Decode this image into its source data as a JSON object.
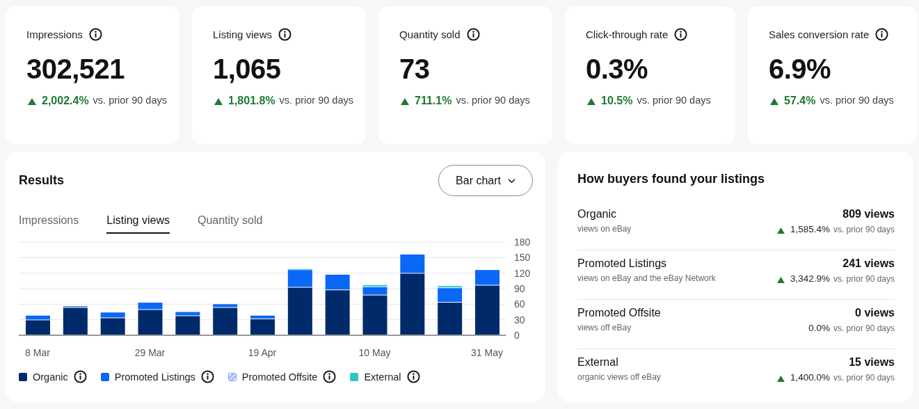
{
  "metrics": [
    {
      "label": "Impressions",
      "value": "302,521",
      "change": "2,002.4%",
      "up": true,
      "comparison": "vs. prior 90 days"
    },
    {
      "label": "Listing views",
      "value": "1,065",
      "change": "1,801.8%",
      "up": true,
      "comparison": "vs. prior 90 days"
    },
    {
      "label": "Quantity sold",
      "value": "73",
      "change": "711.1%",
      "up": true,
      "comparison": "vs. prior 90 days"
    },
    {
      "label": "Click-through rate",
      "value": "0.3%",
      "change": "10.5%",
      "up": true,
      "comparison": "vs. prior 90 days"
    },
    {
      "label": "Sales conversion rate",
      "value": "6.9%",
      "change": "57.4%",
      "up": true,
      "comparison": "vs. prior 90 days"
    }
  ],
  "results": {
    "title": "Results",
    "chart_type_button": "Bar chart",
    "tabs": [
      {
        "label": "Impressions",
        "selected": false
      },
      {
        "label": "Listing views",
        "selected": true
      },
      {
        "label": "Quantity sold",
        "selected": false
      }
    ],
    "legend": [
      {
        "kind": "solid"
      },
      {
        "kind": "solid"
      },
      {
        "kind": "hatched"
      },
      {
        "kind": "solid"
      }
    ],
    "chart_data": {
      "type": "bar",
      "stacked": true,
      "categories": [
        "8 Mar",
        null,
        null,
        "29 Mar",
        null,
        null,
        "19 Apr",
        null,
        null,
        "10 May",
        null,
        null,
        "31 May"
      ],
      "grid": true,
      "ylim": [
        0,
        180
      ],
      "yticks": [
        0,
        30,
        60,
        90,
        120,
        150,
        180
      ],
      "series": [
        {
          "name": "Organic",
          "color": "#012a6b",
          "values": [
            29,
            53,
            33,
            49,
            37,
            53,
            31,
            92,
            87,
            77,
            119,
            63,
            96
          ]
        },
        {
          "name": "Promoted Listings",
          "color": "#0968f6",
          "values": [
            9,
            3,
            11,
            14,
            8,
            7,
            7,
            34,
            30,
            16,
            37,
            28,
            30
          ]
        },
        {
          "name": "Promoted Offsite",
          "color": "#7b9cff",
          "values": [
            0,
            0,
            0,
            0,
            0,
            0,
            0,
            0,
            0,
            0,
            0,
            0,
            0
          ]
        },
        {
          "name": "External",
          "color": "#2ec5c5",
          "values": [
            0,
            0,
            0,
            0,
            0,
            0,
            0,
            2,
            0,
            4,
            0,
            4,
            0
          ]
        }
      ]
    }
  },
  "sources": {
    "title": "How buyers found your listings",
    "items": [
      {
        "name": "Organic",
        "description": "views on eBay",
        "views": "809 views",
        "change": "1,585.4%",
        "up": true,
        "comparison": "vs. prior 90 days"
      },
      {
        "name": "Promoted Listings",
        "description": "views on eBay and the eBay Network",
        "views": "241 views",
        "change": "3,342.9%",
        "up": true,
        "comparison": "vs. prior 90 days"
      },
      {
        "name": "Promoted Offsite",
        "description": "views off eBay",
        "views": "0 views",
        "change": "0.0%",
        "up": false,
        "comparison": "vs. prior 90 days"
      },
      {
        "name": "External",
        "description": "organic views off eBay",
        "views": "15 views",
        "change": "1,400.0%",
        "up": true,
        "comparison": "vs. prior 90 days"
      }
    ]
  }
}
